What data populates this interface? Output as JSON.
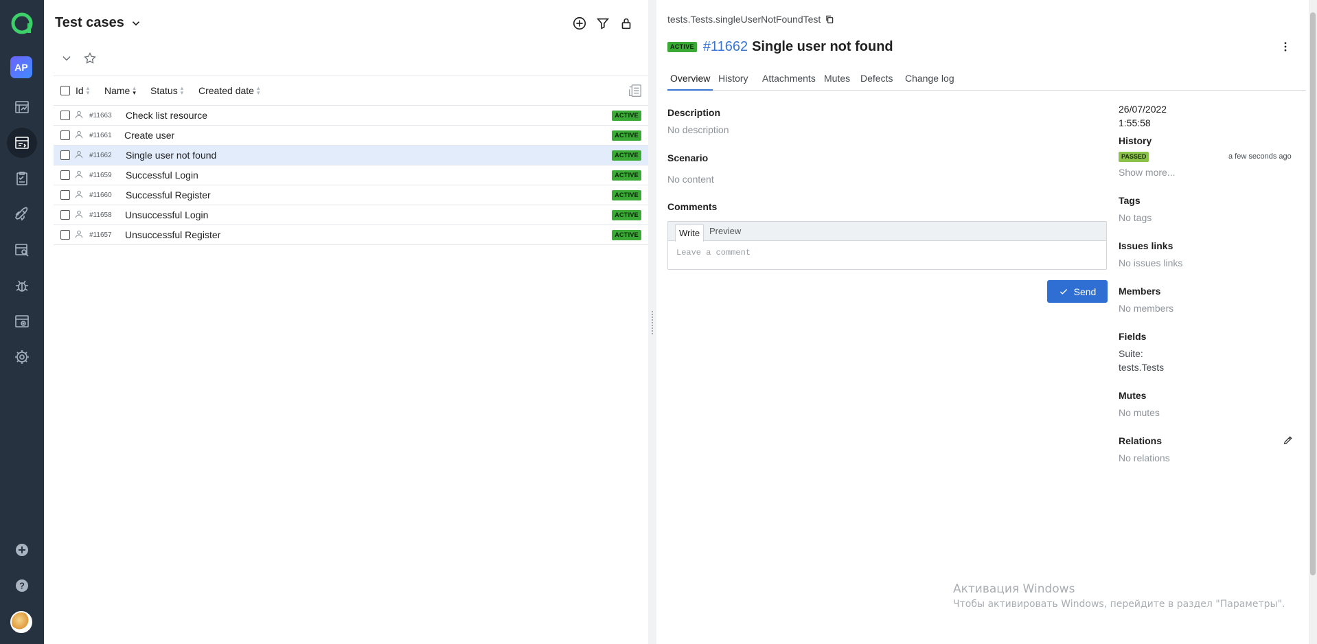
{
  "nav": {
    "project_initials": "AP",
    "items": [
      "dashboards-icon",
      "test-cases-icon",
      "test-plans-icon",
      "launches-icon",
      "analytics-icon",
      "defects-icon",
      "jobs-icon",
      "settings-icon"
    ],
    "bottom": [
      "add-project-icon",
      "help-icon",
      "user-avatar"
    ]
  },
  "left": {
    "title": "Test cases",
    "columns": [
      "Id",
      "Name",
      "Status",
      "Created date"
    ],
    "rows": [
      {
        "id": "#11663",
        "name": "Check list resource",
        "status": "ACTIVE"
      },
      {
        "id": "#11661",
        "name": "Create user",
        "status": "ACTIVE"
      },
      {
        "id": "#11662",
        "name": "Single user not found",
        "status": "ACTIVE",
        "selected": true
      },
      {
        "id": "#11659",
        "name": "Successful Login",
        "status": "ACTIVE"
      },
      {
        "id": "#11660",
        "name": "Successful Register",
        "status": "ACTIVE"
      },
      {
        "id": "#11658",
        "name": "Unsuccessful Login",
        "status": "ACTIVE"
      },
      {
        "id": "#11657",
        "name": "Unsuccessful Register",
        "status": "ACTIVE"
      }
    ]
  },
  "detail": {
    "full_name": "tests.Tests.singleUserNotFoundTest",
    "status": "ACTIVE",
    "id": "#11662",
    "name": "Single user not found",
    "tabs": [
      "Overview",
      "History",
      "Attachments",
      "Mutes",
      "Defects",
      "Change log"
    ],
    "description_label": "Description",
    "description_value": "No description",
    "scenario_label": "Scenario",
    "scenario_value": "No content",
    "comments_label": "Comments",
    "write_tab": "Write",
    "preview_tab": "Preview",
    "comment_placeholder": "Leave a comment",
    "send_label": "Send"
  },
  "side": {
    "created_date": "26/07/2022",
    "created_time": "1:55:58",
    "history_label": "History",
    "history_status": "PASSED",
    "history_when": "a few seconds ago",
    "show_more": "Show more...",
    "tags_label": "Tags",
    "tags_value": "No tags",
    "issues_label": "Issues links",
    "issues_value": "No issues links",
    "members_label": "Members",
    "members_value": "No members",
    "fields_label": "Fields",
    "suite_key": "Suite:",
    "suite_value": "tests.Tests",
    "mutes_label": "Mutes",
    "mutes_value": "No mutes",
    "relations_label": "Relations",
    "relations_value": "No relations"
  },
  "watermark": {
    "title": "Активация Windows",
    "subtitle": "Чтобы активировать Windows, перейдите в раздел \"Параметры\"."
  },
  "colors": {
    "rail": "#263240",
    "accent": "#2f6fd3",
    "active_badge": "#3aa935",
    "passed_badge": "#8bc34a",
    "selected_row": "#e2ecfb"
  }
}
